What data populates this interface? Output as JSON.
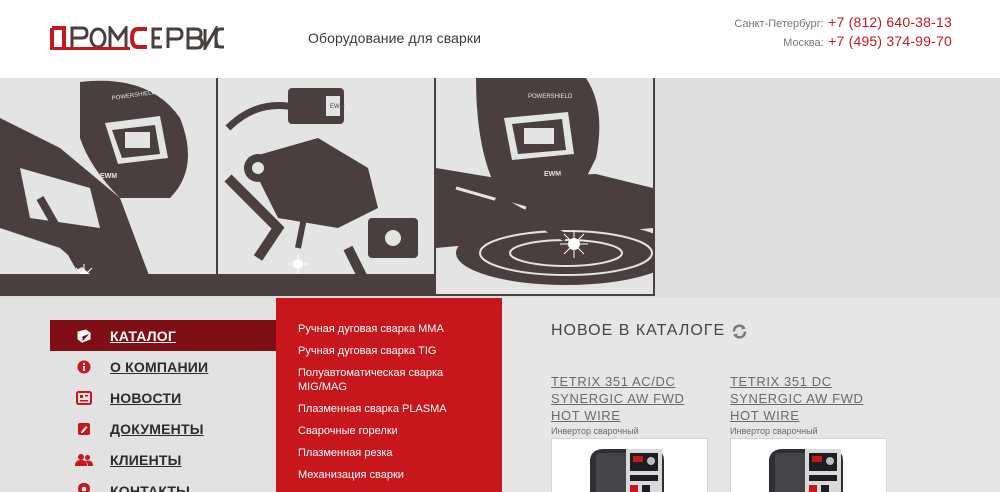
{
  "header": {
    "logo_text": "ПРОМСЕРВИС",
    "tagline": "Оборудование для сварки",
    "contacts": [
      {
        "city": "Санкт-Петербург:",
        "phone": "+7 (812) 640-38-13"
      },
      {
        "city": "Москва:",
        "phone": "+7 (495) 374-99-70"
      }
    ]
  },
  "colors": {
    "brand_red": "#c8161d",
    "dark_red": "#7f0f14",
    "ink": "#4a3f3f"
  },
  "nav": {
    "items": [
      {
        "label": "КАТАЛОГ",
        "icon": "book-icon",
        "active": true
      },
      {
        "label": "О КОМПАНИИ",
        "icon": "info-icon",
        "active": false
      },
      {
        "label": "НОВОСТИ",
        "icon": "newspaper-icon",
        "active": false
      },
      {
        "label": "ДОКУМЕНТЫ",
        "icon": "document-icon",
        "active": false
      },
      {
        "label": "КЛИЕНТЫ",
        "icon": "users-icon",
        "active": false
      },
      {
        "label": "КОНТАКТЫ",
        "icon": "location-pin-icon",
        "active": false
      }
    ]
  },
  "submenu": {
    "items": [
      "Ручная дуговая сварка MMA",
      "Ручная дуговая сварка TIG",
      "Полуавтоматическая сварка MIG/MAG",
      "Плазменная сварка PLASMA",
      "Сварочные горелки",
      "Плазменная резка",
      "Механизация сварки"
    ]
  },
  "new_catalog": {
    "title": "НОВОЕ В КАТАЛОГЕ",
    "refresh_icon": "refresh-icon",
    "products": [
      {
        "name": "TETRIX 351 AC/DC SYNERGIC AW FWD HOT WIRE",
        "type": "Инвертор сварочный"
      },
      {
        "name": "TETRIX 351 DC SYNERGIC AW FWD HOT WIRE",
        "type": "Инвертор сварочный"
      }
    ]
  }
}
